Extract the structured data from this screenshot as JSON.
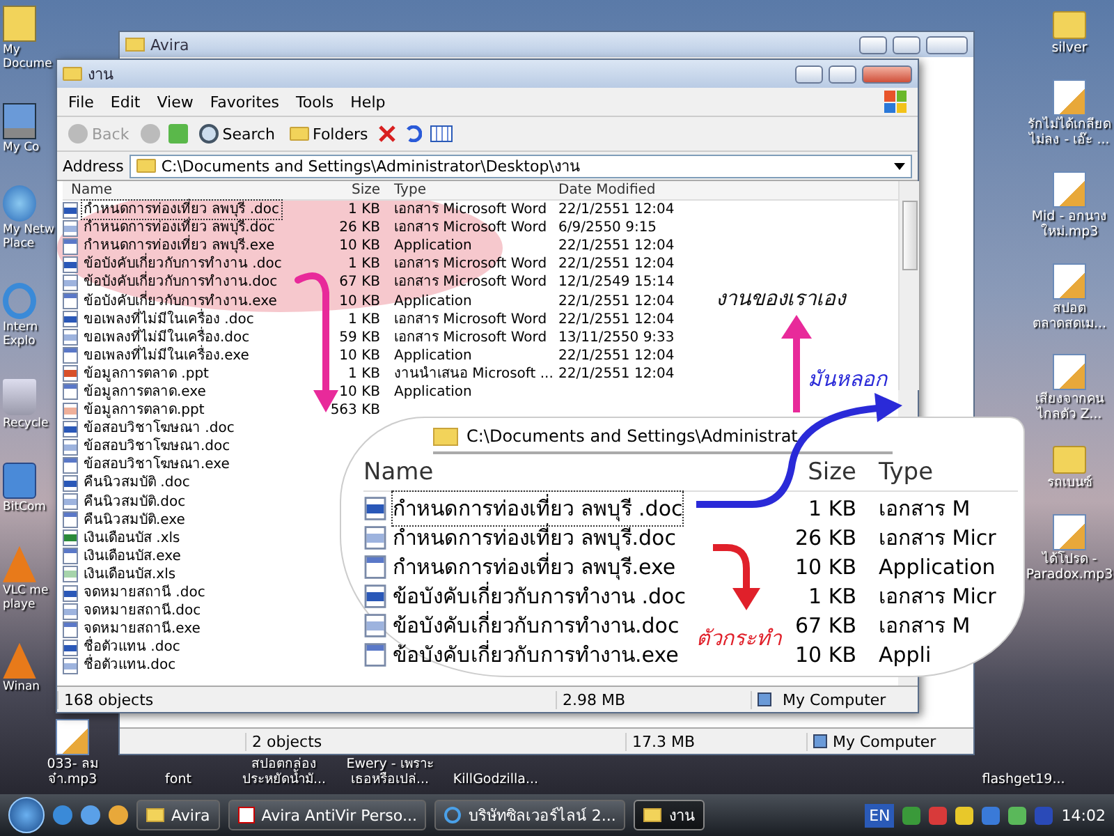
{
  "desktop_icons": {
    "left_column": [
      {
        "label": "My Docume",
        "kind": "documents"
      },
      {
        "label": "My Co",
        "kind": "computer"
      },
      {
        "label": "My Netw Place",
        "kind": "network"
      },
      {
        "label": "Intern Explo",
        "kind": "browser"
      },
      {
        "label": "Recycle",
        "kind": "recycle"
      },
      {
        "label": "BitCom",
        "kind": "app"
      },
      {
        "label": "VLC me playe",
        "kind": "media"
      },
      {
        "label": "Winan",
        "kind": "media"
      }
    ],
    "right_column": [
      {
        "label": "silver",
        "kind": "folder"
      },
      {
        "label": "รักไม่ได้เกลียด ไม่ลง - เอ๊ะ ...",
        "kind": "audio"
      },
      {
        "label": "Mid - อกนาง ใหม่.mp3",
        "kind": "audio"
      },
      {
        "label": "สปอต ตลาดสดเม...",
        "kind": "audio"
      },
      {
        "label": "เสียงจากคน ไกลตัว Z...",
        "kind": "audio"
      },
      {
        "label": "รถเบนซ์",
        "kind": "folder"
      },
      {
        "label": "ได้โปรด - Paradox.mp3",
        "kind": "audio"
      }
    ],
    "bottom_row": [
      {
        "label": "033- ลมจ๋า.mp3",
        "kind": "audio"
      },
      {
        "label": "font"
      },
      {
        "label": "สปอตกล่อง ประหยัดน้ำมั..."
      },
      {
        "label": "Ewery - เพราะ เธอหรือเปล่..."
      },
      {
        "label": "KillGodzilla..."
      },
      {
        "label": "flashget19..."
      }
    ]
  },
  "back_window": {
    "title": "Avira",
    "status_bar": [
      "2 objects",
      "17.3 MB",
      "My Computer"
    ]
  },
  "window": {
    "title": "งาน",
    "menu": [
      "File",
      "Edit",
      "View",
      "Favorites",
      "Tools",
      "Help"
    ],
    "toolbar": {
      "back": "Back",
      "search": "Search",
      "folders": "Folders"
    },
    "address": {
      "label": "Address",
      "value": "C:\\Documents and Settings\\Administrator\\Desktop\\งาน"
    },
    "columns": [
      "Name",
      "Size",
      "Type",
      "Date Modified"
    ],
    "files": [
      {
        "name": "กำหนดการท่องเที่ยว ลพบุรี .doc",
        "kind": "word",
        "selected": true,
        "size": "1 KB",
        "type": "เอกสาร Microsoft Word",
        "date": "22/1/2551 12:04"
      },
      {
        "name": "กำหนดการท่องเที่ยว ลพบุรี.doc",
        "kind": "word-light",
        "selected": false,
        "size": "26 KB",
        "type": "เอกสาร Microsoft Word",
        "date": "6/9/2550 9:15"
      },
      {
        "name": "กำหนดการท่องเที่ยว ลพบุรี.exe",
        "kind": "app",
        "selected": false,
        "size": "10 KB",
        "type": "Application",
        "date": "22/1/2551 12:04"
      },
      {
        "name": "ข้อบังคับเกี่ยวกับการทำงาน .doc",
        "kind": "word",
        "selected": false,
        "size": "1 KB",
        "type": "เอกสาร Microsoft Word",
        "date": "22/1/2551 12:04"
      },
      {
        "name": "ข้อบังคับเกี่ยวกับการทำงาน.doc",
        "kind": "word-light",
        "selected": false,
        "size": "67 KB",
        "type": "เอกสาร Microsoft Word",
        "date": "12/1/2549 15:14"
      },
      {
        "name": "ข้อบังคับเกี่ยวกับการทำงาน.exe",
        "kind": "app",
        "selected": false,
        "size": "10 KB",
        "type": "Application",
        "date": "22/1/2551 12:04"
      },
      {
        "name": "ขอเพลงที่ไม่มีในเครื่อง .doc",
        "kind": "word",
        "selected": false,
        "size": "1 KB",
        "type": "เอกสาร Microsoft Word",
        "date": "22/1/2551 12:04"
      },
      {
        "name": "ขอเพลงที่ไม่มีในเครื่อง.doc",
        "kind": "word-light",
        "selected": false,
        "size": "59 KB",
        "type": "เอกสาร Microsoft Word",
        "date": "13/11/2550 9:33"
      },
      {
        "name": "ขอเพลงที่ไม่มีในเครื่อง.exe",
        "kind": "app",
        "selected": false,
        "size": "10 KB",
        "type": "Application",
        "date": "22/1/2551 12:04"
      },
      {
        "name": "ข้อมูลการตลาด .ppt",
        "kind": "ppt",
        "selected": false,
        "size": "1 KB",
        "type": "งานนำเสนอ Microsoft ...",
        "date": "22/1/2551 12:04"
      },
      {
        "name": "ข้อมูลการตลาด.exe",
        "kind": "app",
        "selected": false,
        "size": "10 KB",
        "type": "Application"
      },
      {
        "name": "ข้อมูลการตลาด.ppt",
        "kind": "ppt-light",
        "selected": false,
        "size": "563 KB"
      },
      {
        "name": "ข้อสอบวิชาโฆษณา .doc",
        "kind": "word",
        "selected": false
      },
      {
        "name": "ข้อสอบวิชาโฆษณา.doc",
        "kind": "word-light",
        "selected": false
      },
      {
        "name": "ข้อสอบวิชาโฆษณา.exe",
        "kind": "app",
        "selected": false
      },
      {
        "name": "คืนนิวสมบัติ .doc",
        "kind": "word",
        "selected": false
      },
      {
        "name": "คืนนิวสมบัติ.doc",
        "kind": "word-light",
        "selected": false
      },
      {
        "name": "คืนนิวสมบัติ.exe",
        "kind": "app",
        "selected": false
      },
      {
        "name": "เงินเดือนบัส .xls",
        "kind": "excel",
        "selected": false
      },
      {
        "name": "เงินเดือนบัส.exe",
        "kind": "app",
        "selected": false
      },
      {
        "name": "เงินเดือนบัส.xls",
        "kind": "excel-light",
        "selected": false
      },
      {
        "name": "จดหมายสถานี .doc",
        "kind": "word",
        "selected": false
      },
      {
        "name": "จดหมายสถานี.doc",
        "kind": "word-light",
        "selected": false
      },
      {
        "name": "จดหมายสถานี.exe",
        "kind": "app",
        "selected": false
      },
      {
        "name": "ชื่อตัวแทน .doc",
        "kind": "word",
        "selected": false
      },
      {
        "name": "ชื่อตัวแทน.doc",
        "kind": "word-light",
        "selected": false
      }
    ],
    "status_bar": [
      "168 objects",
      "2.98 MB",
      "My Computer"
    ]
  },
  "zoom_inset": {
    "address": "C:\\Documents and Settings\\Administrat",
    "columns": [
      "Name",
      "Size",
      "Type"
    ],
    "rows": [
      {
        "name": "กำหนดการท่องเที่ยว ลพบุรี .doc",
        "kind": "word",
        "selected": true,
        "size": "1 KB",
        "type": "เอกสาร M"
      },
      {
        "name": "กำหนดการท่องเที่ยว ลพบุรี.doc",
        "kind": "word-light",
        "selected": false,
        "size": "26 KB",
        "type": "เอกสาร Micr"
      },
      {
        "name": "กำหนดการท่องเที่ยว ลพบุรี.exe",
        "kind": "app",
        "selected": false,
        "size": "10 KB",
        "type": "Application"
      },
      {
        "name": "ข้อบังคับเกี่ยวกับการทำงาน .doc",
        "kind": "word",
        "selected": false,
        "size": "1 KB",
        "type": "เอกสาร Micr"
      },
      {
        "name": "ข้อบังคับเกี่ยวกับการทำงาน.doc",
        "kind": "word-light",
        "selected": false,
        "size": "67 KB",
        "type": "เอกสาร M"
      },
      {
        "name": "ข้อบังคับเกี่ยวกับการทำงาน.exe",
        "kind": "app",
        "selected": false,
        "size": "10 KB",
        "type": "Appli"
      }
    ]
  },
  "annotations": [
    {
      "text": "งานของเราเอง",
      "color": "#111111"
    },
    {
      "text": "มันหลอก",
      "color": "#2a2ad8"
    },
    {
      "text": "ตัวกระทำ",
      "color": "#e0202a"
    }
  ],
  "taskbar": {
    "tasks": [
      {
        "label": "Avira",
        "kind": "folder",
        "selected": false
      },
      {
        "label": "Avira AntiVir Perso...",
        "kind": "antivirus",
        "selected": false
      },
      {
        "label": "บริษัทซิลเวอร์ไลน์ 2...",
        "kind": "browser",
        "selected": false
      },
      {
        "label": "งาน",
        "kind": "folder",
        "selected": true
      }
    ],
    "language": "EN",
    "clock": "14:02"
  }
}
